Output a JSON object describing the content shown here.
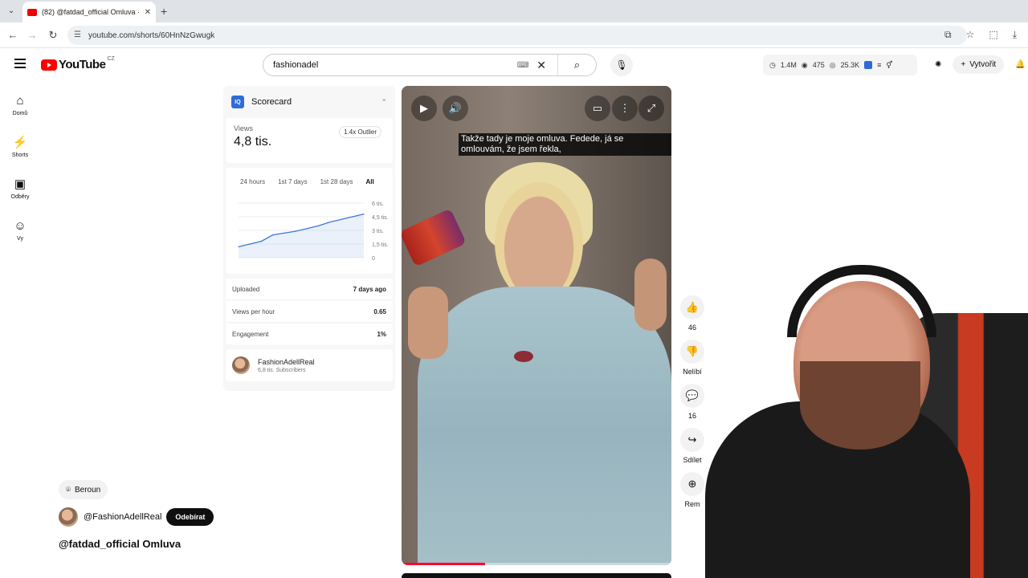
{
  "browser": {
    "tab_title": "(82) @fatdad_official Omluva ·",
    "tab_close": "✕",
    "new_tab": "+",
    "url": "youtube.com/shorts/60HnNzGwugk"
  },
  "header": {
    "logo_text": "YouTube",
    "logo_region": "CZ",
    "search_value": "fashionadel",
    "stats": {
      "subs": "1.4M",
      "likes": "475",
      "views": "25.3K"
    },
    "create_label": "Vytvořit"
  },
  "leftnav": {
    "items": [
      {
        "label": "Domů",
        "icon": "home-icon"
      },
      {
        "label": "Shorts",
        "icon": "shorts-icon"
      },
      {
        "label": "Odběry",
        "icon": "subscriptions-icon"
      },
      {
        "label": "Vy",
        "icon": "account-icon"
      }
    ]
  },
  "scorecard": {
    "title": "Scorecard",
    "views_label": "Views",
    "views_value": "4,8 tis.",
    "outlier": "1.4x Outlier",
    "ranges": [
      "24 hours",
      "1st 7 days",
      "1st 28 days",
      "All"
    ],
    "active_range": "All",
    "y_ticks": [
      "6 tis.",
      "4,5 tis.",
      "3 tis.",
      "1,5 tis.",
      "0"
    ],
    "metrics": [
      {
        "label": "Uploaded",
        "value": "7 days ago"
      },
      {
        "label": "Views per hour",
        "value": "0.65"
      },
      {
        "label": "Engagement",
        "value": "1%"
      }
    ],
    "channel_name": "FashionAdellReal",
    "channel_subs": "6,8 tis. Subscribers"
  },
  "chart_data": {
    "type": "line",
    "y": [
      1200,
      1500,
      1800,
      2500,
      2700,
      2900,
      3200,
      3500,
      3900,
      4200,
      4500,
      4800
    ],
    "ylim": [
      0,
      6000
    ],
    "y_tick_labels": [
      "6 tis.",
      "4,5 tis.",
      "3 tis.",
      "1,5 tis.",
      "0"
    ],
    "grid": true
  },
  "video": {
    "caption": "Takže tady je moje omluva. Fedede, já se omlouvám, že jsem řekla,",
    "progress": 0.31
  },
  "actions": [
    {
      "icon": "like-icon",
      "label": "46"
    },
    {
      "icon": "dislike-icon",
      "label": "Nelíbí"
    },
    {
      "icon": "comment-icon",
      "label": "16"
    },
    {
      "icon": "share-icon",
      "label": "Sdílet"
    },
    {
      "icon": "remix-icon",
      "label": "Rem"
    }
  ],
  "meta": {
    "location": "Beroun",
    "channel_handle": "@FashionAdellReal",
    "subscribe_label": "Odebírat",
    "title": "@fatdad_official Omluva"
  },
  "colors": {
    "accent_red": "#ff0000",
    "chart_line": "#3b78d8",
    "badge_blue": "#2f6bd8"
  }
}
